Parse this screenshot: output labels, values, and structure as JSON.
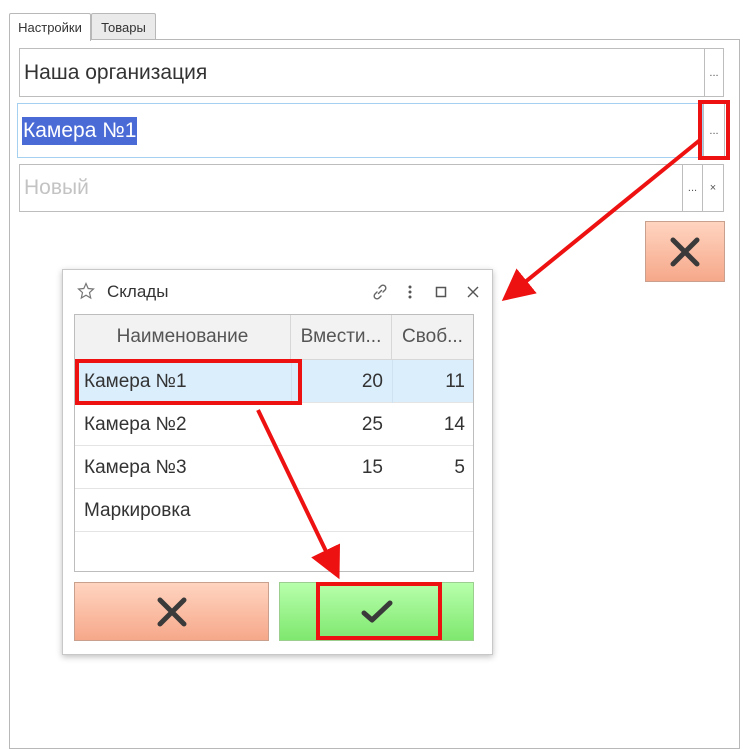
{
  "tabs": [
    {
      "label": "Настройки",
      "active": true
    },
    {
      "label": "Товары",
      "active": false
    }
  ],
  "form": {
    "organization": {
      "value": "Наша организация",
      "btn": "..."
    },
    "warehouse": {
      "value": "Камера №1",
      "btn": "..."
    },
    "new_field": {
      "placeholder": "Новый",
      "btn": "...",
      "clear": "×"
    }
  },
  "dialog": {
    "title": "Склады",
    "columns": [
      "Наименование",
      "Вмести...",
      "Своб..."
    ],
    "rows": [
      {
        "name": "Камера №1",
        "capacity": "20",
        "free": "11",
        "selected": true
      },
      {
        "name": "Камера №2",
        "capacity": "25",
        "free": "14",
        "selected": false
      },
      {
        "name": "Камера №3",
        "capacity": "15",
        "free": "5",
        "selected": false
      },
      {
        "name": "Маркировка",
        "capacity": "",
        "free": "",
        "selected": false
      }
    ]
  },
  "colors": {
    "accent_red": "#ee1111",
    "selection": "#4a6ad6",
    "row_selected": "#dbeefc",
    "cancel": "#f6a88a",
    "ok": "#7fe86e"
  },
  "icons": [
    "star-icon",
    "link-icon",
    "more-icon",
    "maximize-icon",
    "close-icon",
    "cancel-x-icon",
    "checkmark-icon"
  ]
}
